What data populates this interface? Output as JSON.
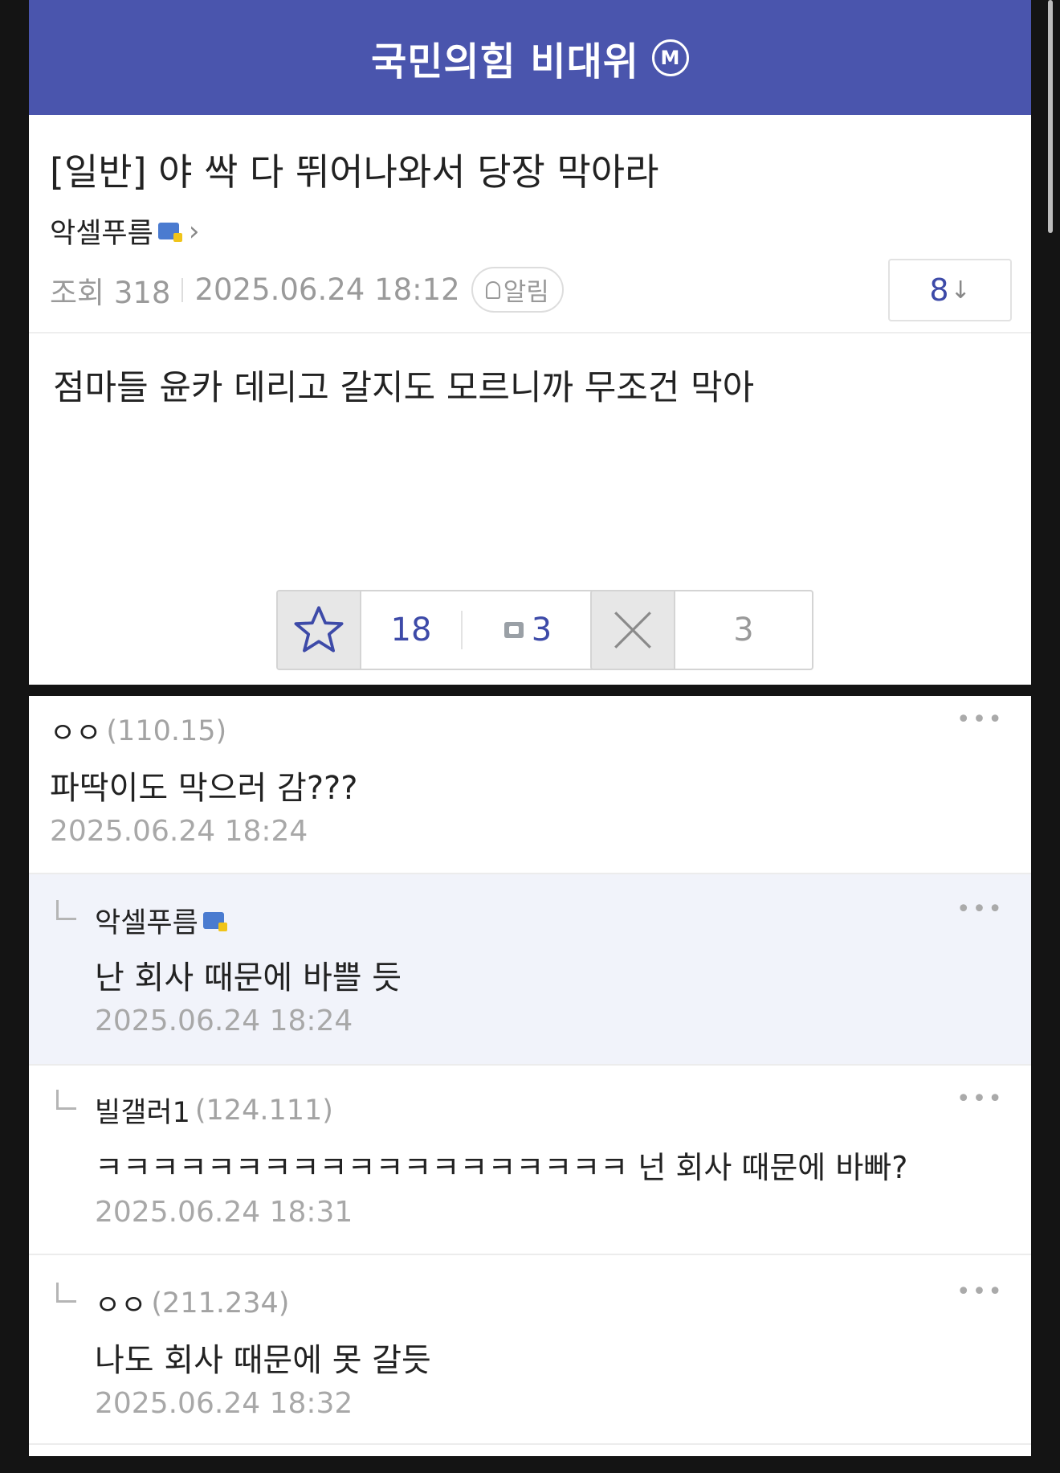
{
  "header": {
    "title": "국민의힘 비대위",
    "badge": "M"
  },
  "post": {
    "title": "[일반] 야 싹 다 뛰어나와서 당장 막아라",
    "author": "악셀푸름",
    "views": "조회 318",
    "datetime": "2025.06.24 18:12",
    "notify_label": "알림",
    "downvote_count": "8",
    "downvote_arrow": "↓",
    "body": "점마들 윤카 데리고 갈지도 모르니까 무조건 막아",
    "like_count": "18",
    "comment_count": "3",
    "dislike_count": "3"
  },
  "comments": [
    {
      "author": "ㅇㅇ",
      "ip": "(110.15)",
      "text": "파딱이도 막으러 감???",
      "date": "2025.06.24 18:24",
      "reply": false,
      "badge": false
    },
    {
      "author": "악셀푸름",
      "ip": "",
      "text": "난 회사 때문에 바쁠 듯",
      "date": "2025.06.24 18:24",
      "reply": true,
      "badge": true
    },
    {
      "author": "빌갤러1",
      "ip": "(124.111)",
      "text": "ㅋㅋㅋㅋㅋㅋㅋㅋㅋㅋㅋㅋㅋㅋㅋㅋㅋㅋㅋ 넌 회사 때문에 바빠?",
      "date": "2025.06.24 18:31",
      "reply": true,
      "badge": false
    },
    {
      "author": "ㅇㅇ",
      "ip": "(211.234)",
      "text": "나도 회사 때문에 못 갈듯",
      "date": "2025.06.24 18:32",
      "reply": true,
      "badge": false
    }
  ],
  "icons": {
    "more": "more-horizontal-icon",
    "star": "star-icon",
    "close": "x-icon",
    "comment": "comment-icon",
    "bell": "bell-icon",
    "chevron": "chevron-right-icon"
  },
  "colors": {
    "header_bg": "#4a55ad",
    "accent": "#3d4aa8",
    "reply_bg": "#f1f3fa"
  }
}
